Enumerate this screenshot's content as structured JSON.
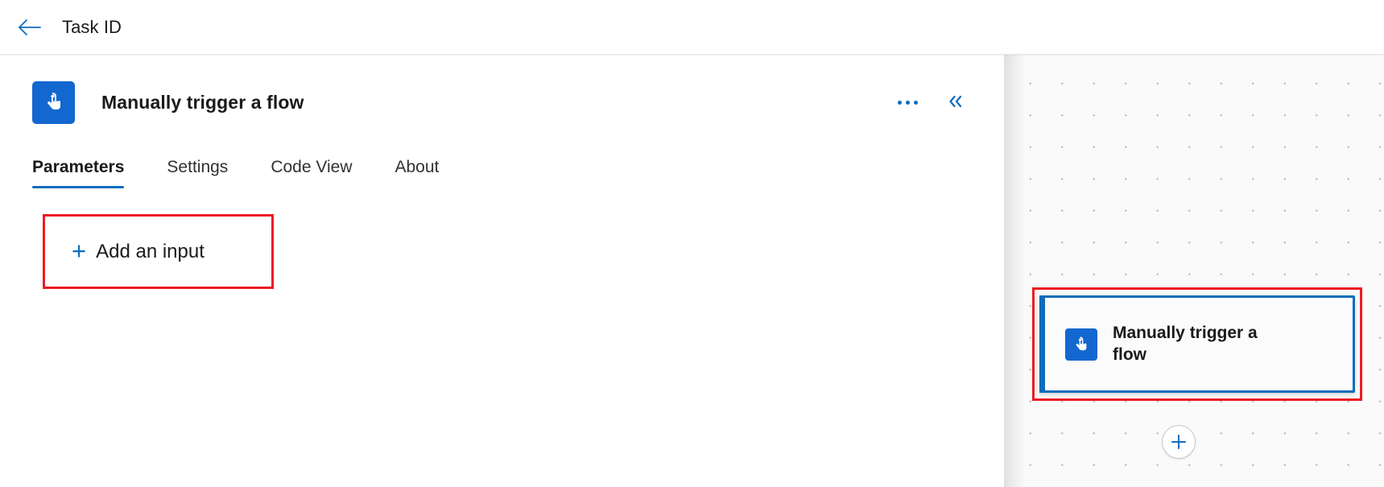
{
  "topbar": {
    "back_icon": "arrow-left-icon",
    "title": "Task ID"
  },
  "panel": {
    "icon": "manual-trigger-touch-icon",
    "title": "Manually trigger a flow",
    "more_options_icon": "ellipsis-icon",
    "collapse_icon": "double-chevron-left-icon",
    "tabs": [
      {
        "label": "Parameters",
        "active": true
      },
      {
        "label": "Settings",
        "active": false
      },
      {
        "label": "Code View",
        "active": false
      },
      {
        "label": "About",
        "active": false
      }
    ],
    "add_input": {
      "plus": "+",
      "label": "Add an input"
    }
  },
  "canvas": {
    "node": {
      "icon": "manual-trigger-touch-icon",
      "title": "Manually trigger a flow",
      "selected": true
    },
    "add_step": {
      "icon": "plus-icon"
    }
  },
  "colors": {
    "accent_blue": "#0f6cbd",
    "icon_blue": "#1267d0",
    "annotation_red": "#ec1c24",
    "text_primary": "#1b1a19",
    "canvas_bg": "#fafafa"
  }
}
